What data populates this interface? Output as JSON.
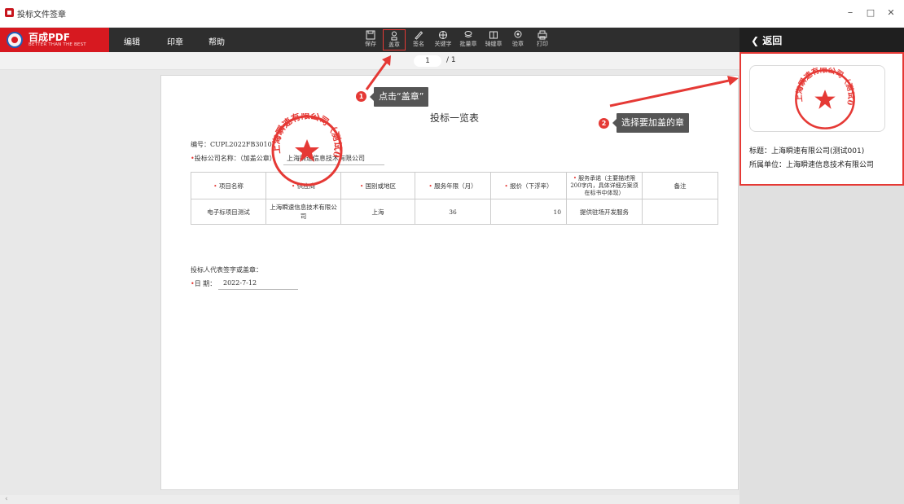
{
  "window": {
    "title": "投标文件签章",
    "minimize": "–",
    "maximize": "□",
    "close": "✕"
  },
  "brand": {
    "name": "百成PDF",
    "slogan": "BETTER THAN THE BEST"
  },
  "menu": [
    "编辑",
    "印章",
    "帮助"
  ],
  "tools": [
    {
      "label": "保存",
      "icon": "save-icon"
    },
    {
      "label": "盖章",
      "icon": "stamp-icon"
    },
    {
      "label": "签名",
      "icon": "signature-icon"
    },
    {
      "label": "关键字",
      "icon": "keyword-icon"
    },
    {
      "label": "批量章",
      "icon": "batch-stamp-icon"
    },
    {
      "label": "骑缝章",
      "icon": "seam-stamp-icon"
    },
    {
      "label": "验章",
      "icon": "verify-stamp-icon"
    },
    {
      "label": "打印",
      "icon": "print-icon"
    }
  ],
  "pager": {
    "current": "1",
    "total": "/ 1"
  },
  "panel": {
    "back_label": "返回",
    "seal_title": "标题：上海瞬速有限公司(测试001)",
    "seal_owner": "所属单位：上海瞬速信息技术有限公司"
  },
  "document": {
    "title": "投标一览表",
    "number": "编号：CUPL2022FB3010",
    "company_label": "投标公司名称：（加盖公章）",
    "company_value": "上海瞬速信息技术有限公司",
    "table": {
      "headers": [
        "项目名称",
        "供应商",
        "国别或地区",
        "服务年限（月）",
        "报价（下浮率）",
        "服务承诺（主要描述限200字内，具体详细方案须在标书中体现）",
        "备注"
      ],
      "rows": [
        [
          "电子标项目测试",
          "上海瞬速信息技术有限公司",
          "上海",
          "36",
          "10",
          "提供驻场开发服务",
          ""
        ]
      ]
    },
    "signer_label": "投标人代表签字或盖章：",
    "date_label": "日  期：",
    "date_value": "2022-7-12"
  },
  "seal": {
    "text": "上海瞬速有限公司（测试001）",
    "color": "#e53935"
  },
  "annotations": [
    {
      "number": "1",
      "text": "点击“盖章”"
    },
    {
      "number": "2",
      "text": "选择要加盖的章"
    }
  ],
  "colors": {
    "accent": "#d71920",
    "annotation": "#e53935"
  }
}
